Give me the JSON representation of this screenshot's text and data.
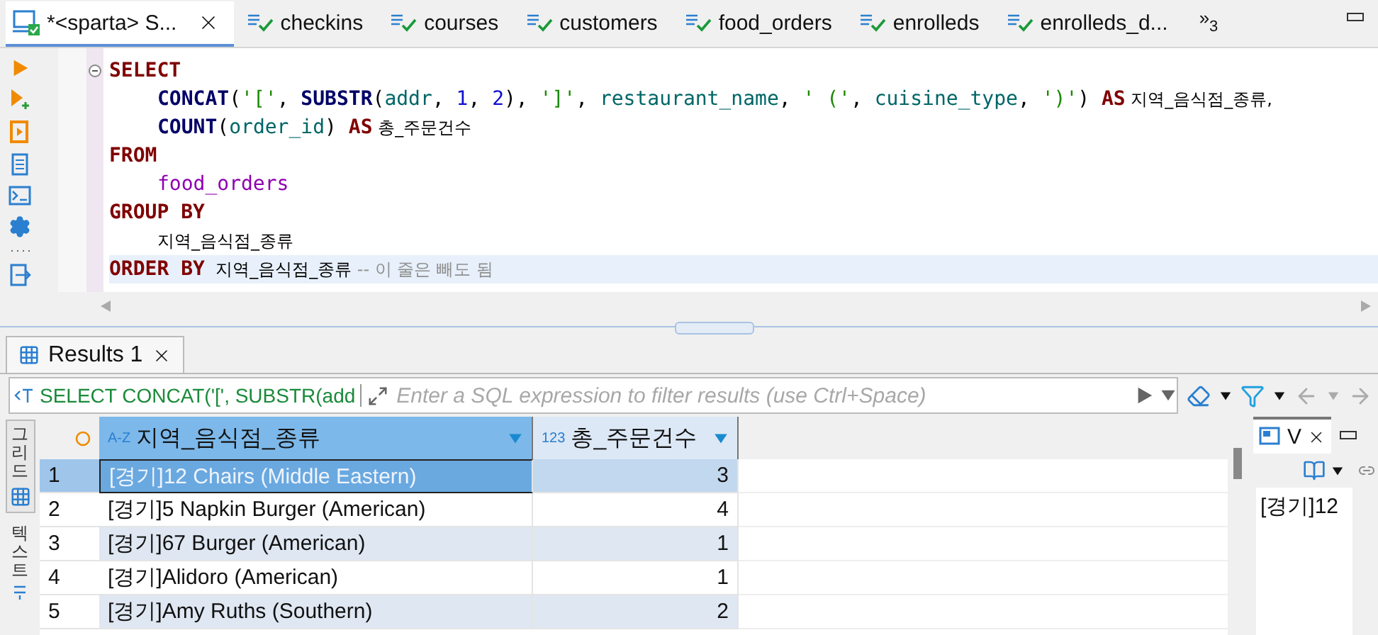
{
  "editor_tabs": [
    {
      "label": "*<sparta> S...",
      "selected": true,
      "kind": "script"
    },
    {
      "label": "checkins",
      "selected": false,
      "kind": "table"
    },
    {
      "label": "courses",
      "selected": false,
      "kind": "table"
    },
    {
      "label": "customers",
      "selected": false,
      "kind": "table"
    },
    {
      "label": "food_orders",
      "selected": false,
      "kind": "table"
    },
    {
      "label": "enrolleds",
      "selected": false,
      "kind": "table"
    },
    {
      "label": "enrolleds_d...",
      "selected": false,
      "kind": "table"
    }
  ],
  "tab_overflow": {
    "chevrons": "»",
    "count": "3"
  },
  "code_lines": [
    {
      "indented": false,
      "current": false,
      "tokens": [
        {
          "kind": "keyword",
          "text": "SELECT"
        }
      ]
    },
    {
      "indented": true,
      "current": false,
      "tokens": [
        {
          "kind": "function",
          "text": "CONCAT"
        },
        {
          "kind": "plain",
          "text": "("
        },
        {
          "kind": "string",
          "text": "'['"
        },
        {
          "kind": "plain",
          "text": ", "
        },
        {
          "kind": "function",
          "text": "SUBSTR"
        },
        {
          "kind": "plain",
          "text": "("
        },
        {
          "kind": "column",
          "text": "addr"
        },
        {
          "kind": "plain",
          "text": ", "
        },
        {
          "kind": "number",
          "text": "1"
        },
        {
          "kind": "plain",
          "text": ", "
        },
        {
          "kind": "number",
          "text": "2"
        },
        {
          "kind": "plain",
          "text": "), "
        },
        {
          "kind": "string",
          "text": "']'"
        },
        {
          "kind": "plain",
          "text": ", "
        },
        {
          "kind": "column",
          "text": "restaurant_name"
        },
        {
          "kind": "plain",
          "text": ", "
        },
        {
          "kind": "string",
          "text": "' ('"
        },
        {
          "kind": "plain",
          "text": ", "
        },
        {
          "kind": "column",
          "text": "cuisine_type"
        },
        {
          "kind": "plain",
          "text": ", "
        },
        {
          "kind": "string",
          "text": "')'"
        },
        {
          "kind": "plain",
          "text": ") "
        },
        {
          "kind": "keyword",
          "text": "AS"
        },
        {
          "kind": "alias",
          "text": " 지역_음식점_종류,"
        }
      ]
    },
    {
      "indented": true,
      "current": false,
      "tokens": [
        {
          "kind": "function",
          "text": "COUNT"
        },
        {
          "kind": "plain",
          "text": "("
        },
        {
          "kind": "column",
          "text": "order_id"
        },
        {
          "kind": "plain",
          "text": ") "
        },
        {
          "kind": "keyword",
          "text": "AS"
        },
        {
          "kind": "alias",
          "text": " 총_주문건수"
        }
      ]
    },
    {
      "indented": false,
      "current": false,
      "tokens": [
        {
          "kind": "keyword",
          "text": "FROM"
        }
      ]
    },
    {
      "indented": true,
      "current": false,
      "tokens": [
        {
          "kind": "table",
          "text": "food_orders"
        }
      ]
    },
    {
      "indented": false,
      "current": false,
      "tokens": [
        {
          "kind": "keyword",
          "text": "GROUP BY"
        }
      ]
    },
    {
      "indented": true,
      "current": false,
      "tokens": [
        {
          "kind": "alias",
          "text": "지역_음식점_종류"
        }
      ]
    },
    {
      "indented": false,
      "current": true,
      "tokens": [
        {
          "kind": "keyword",
          "text": "ORDER BY"
        },
        {
          "kind": "alias",
          "text": "  지역_음식점_종류"
        },
        {
          "kind": "comment",
          "text": " -- 이 줄은 빼도 됨"
        }
      ]
    }
  ],
  "results_tab": {
    "label": "Results 1",
    "selected": true
  },
  "filter_bar": {
    "query": "SELECT CONCAT('[', SUBSTR(add",
    "placeholder": "Enter a SQL expression to filter results (use Ctrl+Space)"
  },
  "view_tabs": [
    {
      "label": "그리드",
      "selected": true
    },
    {
      "label": "텍스트",
      "selected": false
    }
  ],
  "table": {
    "columns": [
      {
        "type": "A-Z",
        "name": "지역_음식점_종류"
      },
      {
        "type": "123",
        "name": "총_주문건수"
      }
    ],
    "rows": [
      {
        "number": "1",
        "selected": true,
        "cells": [
          "[경기]12 Chairs (Middle Eastern)",
          "3"
        ]
      },
      {
        "number": "2",
        "selected": false,
        "cells": [
          "[경기]5 Napkin Burger (American)",
          "4"
        ]
      },
      {
        "number": "3",
        "selected": false,
        "cells": [
          "[경기]67 Burger (American)",
          "1"
        ]
      },
      {
        "number": "4",
        "selected": false,
        "cells": [
          "[경기]Alidoro (American)",
          "1"
        ]
      },
      {
        "number": "5",
        "selected": false,
        "cells": [
          "[경기]Amy Ruths (Southern)",
          "2"
        ]
      }
    ]
  },
  "value_panel": {
    "tab": "V",
    "value": "[경기]12"
  }
}
